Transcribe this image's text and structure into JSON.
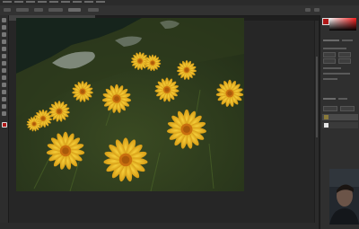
{
  "menubar": {
    "items": [
      "",
      "",
      "",
      "",
      "",
      "",
      "",
      "",
      ""
    ]
  },
  "options_bar": {
    "labels": [
      "",
      "",
      ""
    ]
  },
  "document": {
    "tab_title": ""
  },
  "status": {
    "text": ""
  },
  "panels": {
    "color_heading": "",
    "properties_heading": "",
    "layers_heading": "",
    "layers": [
      {
        "name": ""
      },
      {
        "name": ""
      }
    ]
  },
  "colors": {
    "foreground": "#b01818",
    "accent": "#e8b21e",
    "ui_background": "#1e1e1e"
  },
  "icons": [
    "move-icon",
    "marquee-icon",
    "lasso-icon",
    "crop-icon",
    "eyedropper-icon",
    "healing-icon",
    "brush-icon",
    "stamp-icon",
    "eraser-icon",
    "gradient-icon",
    "pen-icon",
    "type-icon",
    "hand-icon",
    "zoom-icon"
  ]
}
